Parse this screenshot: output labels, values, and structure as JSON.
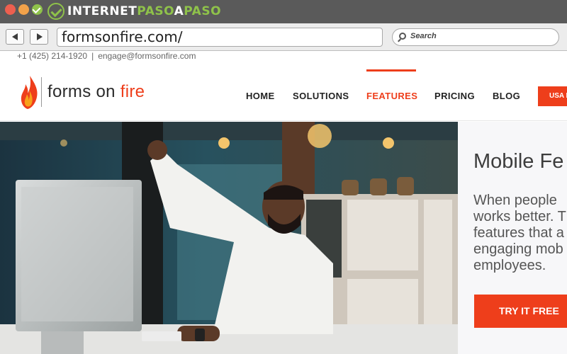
{
  "browser": {
    "brand_part1": "INTERNET",
    "brand_part2": "PASO",
    "brand_part3": "A",
    "brand_part4": "PASO",
    "url": "formsonfire.com/",
    "search_placeholder": "Search"
  },
  "header": {
    "phone": "+1 (425) 214-1920",
    "separator": "|",
    "email": "engage@formsonfire.com",
    "logo_text_main": "forms on ",
    "logo_text_accent": "fire",
    "nav": [
      {
        "label": "HOME"
      },
      {
        "label": "SOLUTIONS"
      },
      {
        "label": "FEATURES"
      },
      {
        "label": "PRICING"
      },
      {
        "label": "BLOG"
      }
    ],
    "active_nav": "FEATURES",
    "cta": "USA F"
  },
  "hero": {
    "title": "Mobile Fe",
    "text_lines": [
      "When people",
      "works better. T",
      "features that a",
      "engaging mob",
      "employees."
    ],
    "button": "TRY IT FREE"
  },
  "colors": {
    "accent": "#ee3e1b",
    "chrome": "#5a5a5a",
    "brand_green": "#8fc24a"
  }
}
